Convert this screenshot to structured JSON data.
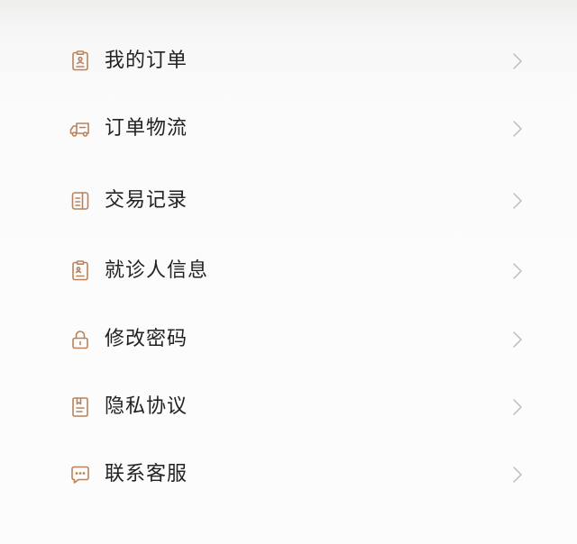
{
  "menu": {
    "items": [
      {
        "label": "我的订单",
        "icon": "order-clipboard-icon"
      },
      {
        "label": "订单物流",
        "icon": "delivery-truck-icon"
      },
      {
        "label": "交易记录",
        "icon": "transaction-record-icon"
      },
      {
        "label": "就诊人信息",
        "icon": "patient-info-icon"
      },
      {
        "label": "修改密码",
        "icon": "lock-icon"
      },
      {
        "label": "隐私协议",
        "icon": "privacy-document-icon"
      },
      {
        "label": "联系客服",
        "icon": "chat-bubble-icon"
      }
    ]
  },
  "colors": {
    "icon_accent": "#b9825a",
    "label": "#222222",
    "chevron": "#bcbcbc"
  }
}
